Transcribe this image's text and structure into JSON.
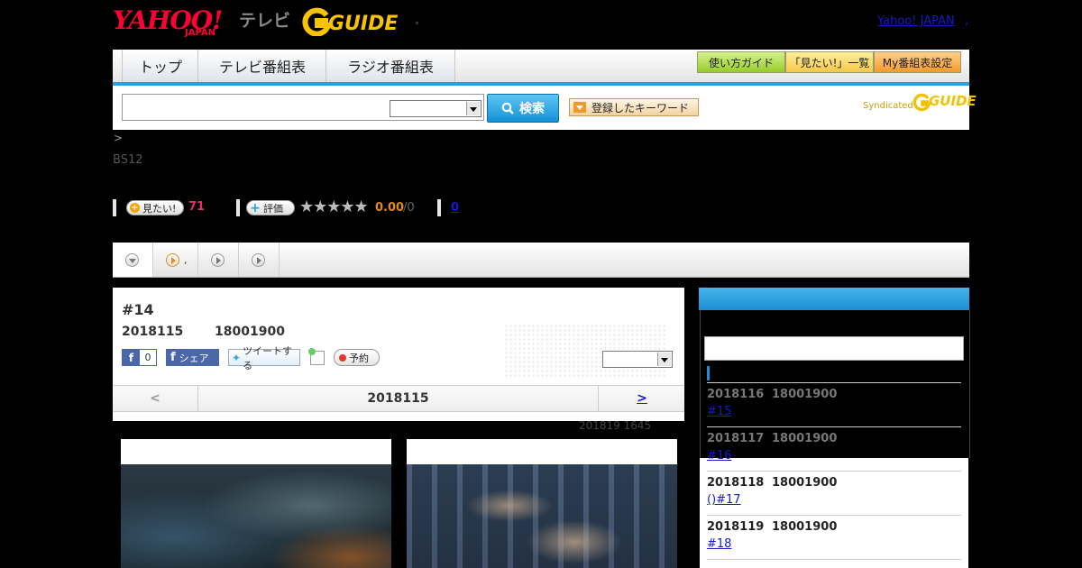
{
  "header": {
    "yahoo_logo_main": "YAHOO!",
    "yahoo_logo_sub": "JAPAN",
    "tv_label": "テレビ",
    "gguide_logo": "GUIDE",
    "yahoo_japan_link": "Yahoo! JAPAN",
    "comma": ","
  },
  "nav": {
    "tabs": [
      {
        "label": "トップ"
      },
      {
        "label": "テレビ番組表"
      },
      {
        "label": "ラジオ番組表"
      }
    ],
    "buttons": [
      {
        "label": "使い方ガイド"
      },
      {
        "label": "「見たい!」一覧"
      },
      {
        "label": "My番組表設定"
      }
    ]
  },
  "search": {
    "placeholder": "",
    "select_value": "",
    "button_label": "検索",
    "keyword_button": "登録したキーワード",
    "syndicated": "Syndicated",
    "syndicated_g": "GUIDE"
  },
  "breadcrumb": ">",
  "channel": "BS12",
  "stats": {
    "want_label": "見たい!",
    "want_count": "71",
    "rate_label": "評価",
    "stars": "★★★★★",
    "rating": "0.00",
    "rating_total": "/0",
    "comments": "0"
  },
  "subtabs": [
    {
      "label": ""
    },
    {
      "label": ","
    },
    {
      "label": ""
    },
    {
      "label": ""
    }
  ],
  "program": {
    "title": "#14",
    "date": "2018115",
    "time": "18001900",
    "fb_like_count": "0",
    "fb_share": "シェア",
    "tweet": "ツイートする",
    "reserve": "予約",
    "select_value": "",
    "prev": "<",
    "current": "2018115",
    "next": ">",
    "updated": "201819  1645"
  },
  "sidebar": {
    "header": "",
    "search_value": "",
    "items": [
      {
        "date": "2018116",
        "time": "18001900",
        "title": "#15"
      },
      {
        "date": "2018117",
        "time": "18001900",
        "title": "#16"
      },
      {
        "date": "2018118",
        "time": "18001900",
        "title": "()#17"
      },
      {
        "date": "2018119",
        "time": "18001900",
        "title": "#18"
      }
    ]
  },
  "colors": {
    "accent_blue": "#2a9fd8",
    "want_pink": "#e0306a",
    "rating_orange": "#e08a1e",
    "link_blue": "#1a1ac8"
  }
}
